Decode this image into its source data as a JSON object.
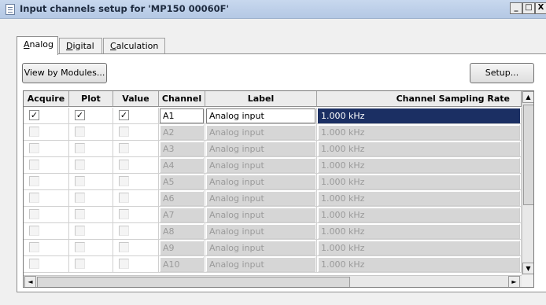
{
  "window": {
    "title": "Input channels setup for 'MP150 00060F'",
    "controls": {
      "minimize": "_",
      "maximize": "□",
      "close": "X"
    }
  },
  "tabs": [
    {
      "label": "Analog",
      "underline": "A",
      "rest": "nalog",
      "active": true
    },
    {
      "label": "Digital",
      "underline": "D",
      "rest": "igital",
      "active": false
    },
    {
      "label": "Calculation",
      "underline": "C",
      "rest": "alculation",
      "active": false
    }
  ],
  "toolbar": {
    "view_by_modules": "View by Modules...",
    "setup": "Setup..."
  },
  "grid": {
    "columns": [
      "Acquire",
      "Plot",
      "Value",
      "Channel",
      "Label",
      "Channel Sampling Rate"
    ],
    "rows": [
      {
        "acquire": true,
        "plot": true,
        "value": true,
        "channel": "A1",
        "label": "Analog input",
        "rate": "1.000 kHz",
        "enabled": true,
        "selected": true
      },
      {
        "acquire": false,
        "plot": false,
        "value": false,
        "channel": "A2",
        "label": "Analog input",
        "rate": "1.000 kHz",
        "enabled": false,
        "selected": false
      },
      {
        "acquire": false,
        "plot": false,
        "value": false,
        "channel": "A3",
        "label": "Analog input",
        "rate": "1.000 kHz",
        "enabled": false,
        "selected": false
      },
      {
        "acquire": false,
        "plot": false,
        "value": false,
        "channel": "A4",
        "label": "Analog input",
        "rate": "1.000 kHz",
        "enabled": false,
        "selected": false
      },
      {
        "acquire": false,
        "plot": false,
        "value": false,
        "channel": "A5",
        "label": "Analog input",
        "rate": "1.000 kHz",
        "enabled": false,
        "selected": false
      },
      {
        "acquire": false,
        "plot": false,
        "value": false,
        "channel": "A6",
        "label": "Analog input",
        "rate": "1.000 kHz",
        "enabled": false,
        "selected": false
      },
      {
        "acquire": false,
        "plot": false,
        "value": false,
        "channel": "A7",
        "label": "Analog input",
        "rate": "1.000 kHz",
        "enabled": false,
        "selected": false
      },
      {
        "acquire": false,
        "plot": false,
        "value": false,
        "channel": "A8",
        "label": "Analog input",
        "rate": "1.000 kHz",
        "enabled": false,
        "selected": false
      },
      {
        "acquire": false,
        "plot": false,
        "value": false,
        "channel": "A9",
        "label": "Analog input",
        "rate": "1.000 kHz",
        "enabled": false,
        "selected": false
      },
      {
        "acquire": false,
        "plot": false,
        "value": false,
        "channel": "A10",
        "label": "Analog input",
        "rate": "1.000 kHz",
        "enabled": false,
        "selected": false
      }
    ]
  },
  "scrollbar": {
    "up": "▲",
    "down": "▼",
    "left": "◄",
    "right": "►"
  },
  "check_mark": "✓",
  "colors": {
    "selection": "#1b2f63",
    "disabled_field": "#d6d6d6"
  }
}
